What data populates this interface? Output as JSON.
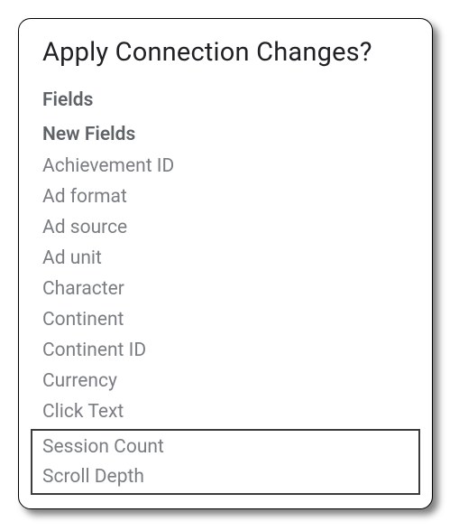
{
  "dialog": {
    "title": "Apply Connection Changes?",
    "section_heading": "Fields",
    "subsection_heading": "New Fields",
    "fields": [
      "Achievement ID",
      "Ad format",
      "Ad source",
      "Ad unit",
      "Character",
      "Continent",
      "Continent ID",
      "Currency",
      "Click Text"
    ],
    "highlighted_fields": [
      "Session Count",
      "Scroll Depth"
    ]
  }
}
